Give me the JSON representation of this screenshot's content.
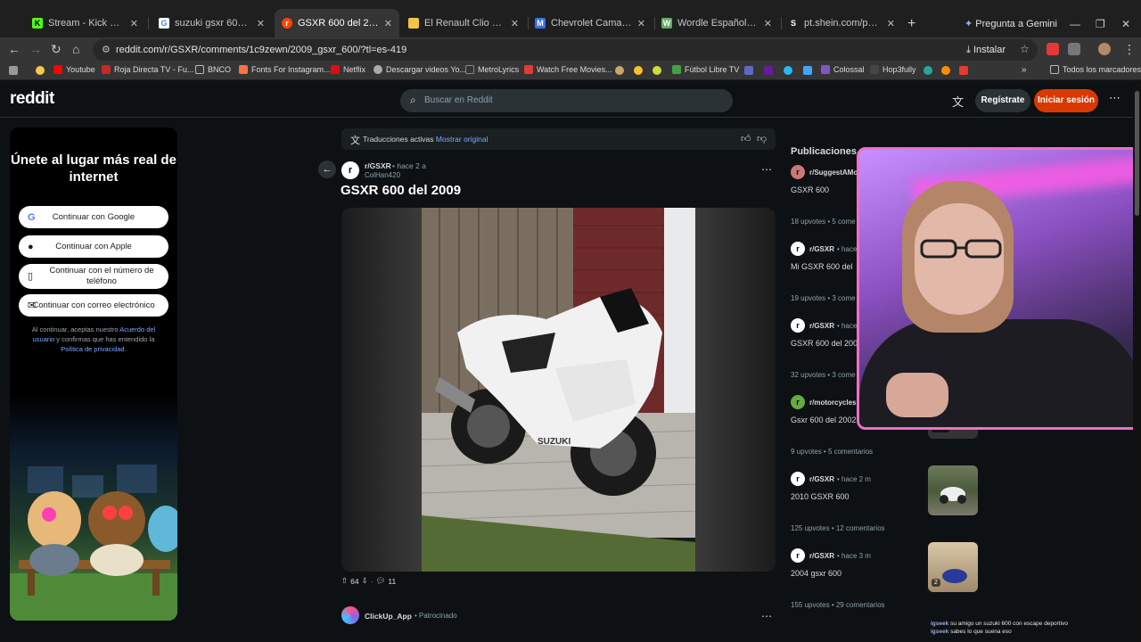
{
  "browser": {
    "tabs": [
      {
        "title": "Stream - Kick Dashboard",
        "icon": "kick-icon",
        "color": "#53fc18",
        "letter": "K"
      },
      {
        "title": "suzuki gsxr 600 blanca - B",
        "icon": "google-icon",
        "color": "#ffffff",
        "letter": "G"
      },
      {
        "title": "GSXR 600 del 2009 : r/GSX",
        "icon": "reddit-icon",
        "color": "#ff4500",
        "letter": "r",
        "active": true
      },
      {
        "title": "El Renault Clio cumple 30",
        "icon": "news-icon",
        "color": "#f4c542",
        "letter": ""
      },
      {
        "title": "Chevrolet Camaro: la otra",
        "icon": "ml-icon",
        "color": "#3d6ee8",
        "letter": "M"
      },
      {
        "title": "Wordle Español - Wordle",
        "icon": "wordle-icon",
        "color": "#6aaa64",
        "letter": "W"
      },
      {
        "title": "pt.shein.com/pay/result/su",
        "icon": "shein-icon",
        "color": "#ffffff",
        "letter": "S"
      }
    ],
    "gemini_label": "Pregunta a Gemini",
    "url": "reddit.com/r/GSXR/comments/1c9zewn/2009_gsxr_600/?tl=es-419",
    "install_label": "Instalar",
    "bookmarks": [
      {
        "label": "Youtube",
        "color": "#ff0000"
      },
      {
        "label": "Roja Directa TV - Fu...",
        "color": "#c62828"
      },
      {
        "label": "BNCO",
        "color": "#999999"
      },
      {
        "label": "Fonts For Instagram...",
        "color": "#ff7043"
      },
      {
        "label": "Netflix",
        "color": "#e50914"
      },
      {
        "label": "Descargar videos Yo...",
        "color": "#aaaaaa"
      },
      {
        "label": "MetroLyrics",
        "color": "#333333"
      },
      {
        "label": "Watch Free Movies...",
        "color": "#e53935"
      },
      {
        "label": "Fútbol Libre TV",
        "color": "#43a047"
      },
      {
        "label": "Colossal",
        "color": "#7e57c2"
      },
      {
        "label": "Hop3fully",
        "color": "#444444"
      },
      {
        "label": "Todos los marcadores",
        "color": "#999999"
      }
    ]
  },
  "reddit": {
    "logo": "reddit",
    "search_placeholder": "Buscar en Reddit",
    "register_label": "Regístrate",
    "login_label": "Iniciar sesión"
  },
  "signup": {
    "title": "Únete al lugar más real de internet",
    "buttons": [
      {
        "label": "Continuar con Google",
        "icon": "google-icon"
      },
      {
        "label": "Continuar con Apple",
        "icon": "apple-icon"
      },
      {
        "label": "Continuar con el número de teléfono",
        "icon": "phone-icon"
      },
      {
        "label": "Continuar con correo electrónico",
        "icon": "mail-icon"
      }
    ],
    "legal_1": "Al continuar, aceptas nuestro ",
    "legal_link_1": "Acuerdo del usuario",
    "legal_2": " y confirmas que has entendido la ",
    "legal_link_2": "Política de privacidad",
    "legal_3": "."
  },
  "post": {
    "translation_text": "Traducciones activas",
    "translation_link": "Mostrar original",
    "subreddit": "r/GSXR",
    "time": "• hace 2 a",
    "author": "ColHan420",
    "title": "GSXR 600 del 2009",
    "upvotes": "64",
    "comments": "11"
  },
  "ad": {
    "name": "ClickUp_App",
    "tag": "• Patrocinado"
  },
  "sidebar": {
    "title": "Publicaciones recientes",
    "items": [
      {
        "sub": "r/SuggestAMo",
        "time": "",
        "post": "GSXR 600",
        "meta": "18 upvotes • 5 come",
        "thumb": false
      },
      {
        "sub": "r/GSXR",
        "time": "• hace",
        "post": "Mi GSXR 600 del",
        "meta": "19 upvotes • 3 come",
        "thumb": false
      },
      {
        "sub": "r/GSXR",
        "time": "• hace",
        "post": "GSXR 600 del 200",
        "meta": "32 upvotes • 3 come",
        "thumb": false
      },
      {
        "sub": "r/motorcycles",
        "time": "",
        "post": "Gsxr 600 del 2002",
        "meta": "9 upvotes • 5 comentarios",
        "thumb": true,
        "badge": "0:12"
      },
      {
        "sub": "r/GSXR",
        "time": "• hace 2 m",
        "post": "2010 GSXR 600",
        "meta": "125 upvotes • 12 comentarios",
        "thumb": true,
        "badge": ""
      },
      {
        "sub": "r/GSXR",
        "time": "• hace 3 m",
        "post": "2004 gsxr 600",
        "meta": "155 upvotes • 29 comentarios",
        "thumb": true,
        "badge": "2"
      }
    ]
  },
  "chat": {
    "line1_user": "igseek",
    "line1": "su amigo un suzuki 600 con escape deportivo",
    "line2_user": "igseek",
    "line2": "sabes lo que suena eso"
  }
}
